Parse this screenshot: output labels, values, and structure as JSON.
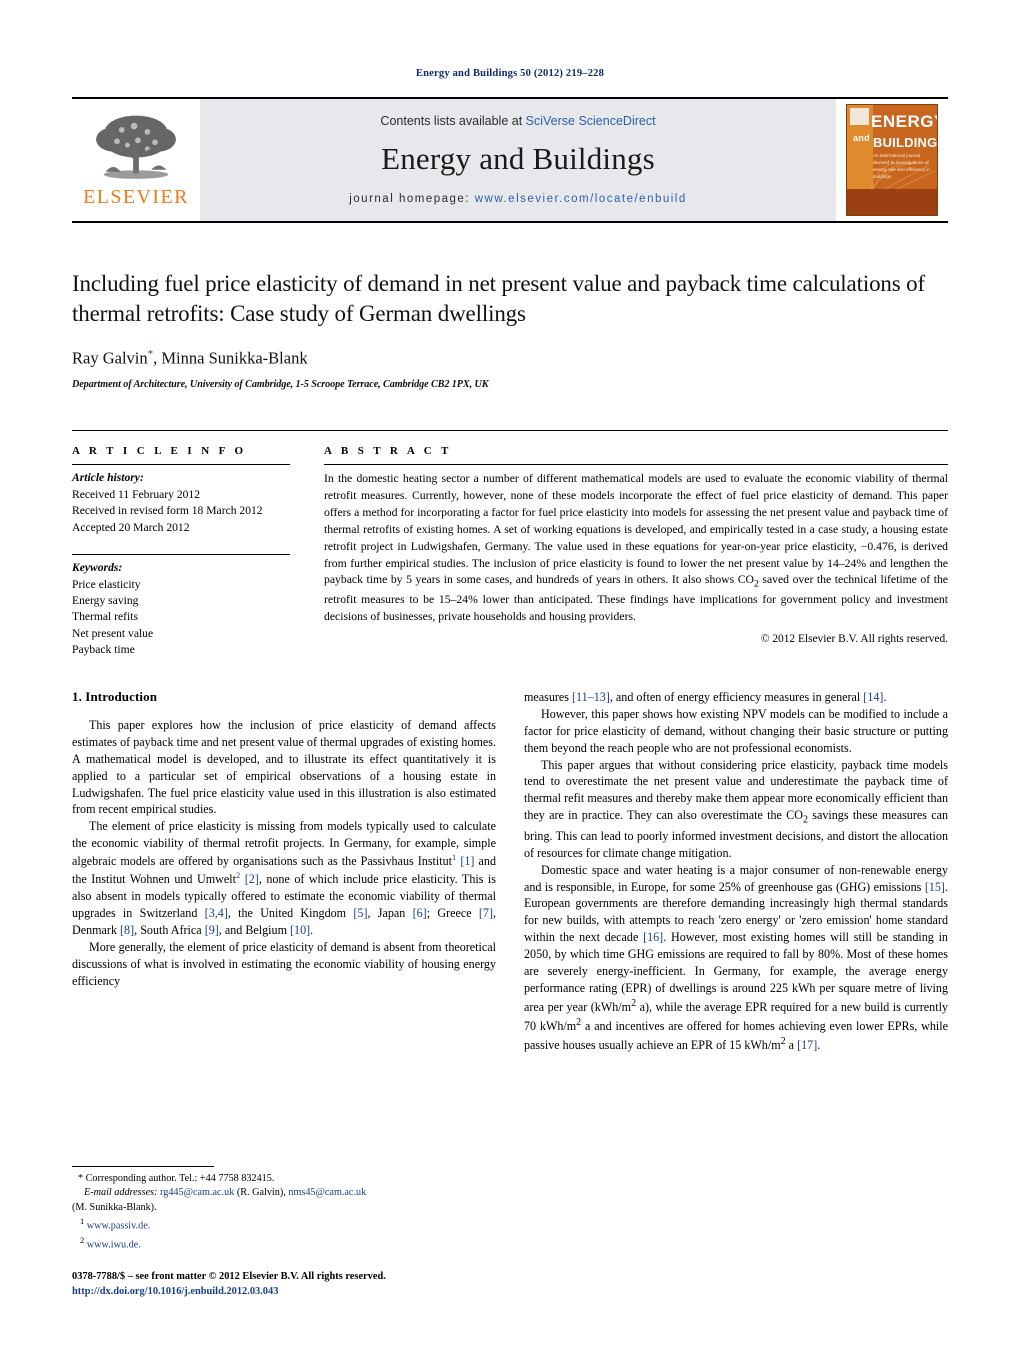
{
  "running_head": "Energy and Buildings 50 (2012) 219–228",
  "masthead": {
    "contents_prefix": "Contents lists available at ",
    "contents_link": "SciVerse ScienceDirect",
    "journal_name": "Energy and Buildings",
    "homepage_prefix": "journal homepage: ",
    "homepage_url": "www.elsevier.com/locate/enbuild",
    "publisher_wordmark": "ELSEVIER",
    "cover": {
      "line1": "ENERGY",
      "line2": "and",
      "line3": "BUILDINGS",
      "subtitle": "An international journal devoted to investigations of energy use and efficiency in buildings"
    }
  },
  "article": {
    "title": "Including fuel price elasticity of demand in net present value and payback time calculations of thermal retrofits: Case study of German dwellings",
    "authors": "Ray Galvin",
    "author_marker": "*",
    "authors_rest": ", Minna Sunikka-Blank",
    "affiliation": "Department of Architecture, University of Cambridge, 1-5 Scroope Terrace, Cambridge CB2 1PX, UK"
  },
  "info": {
    "heading": "A R T I C L E  I N F O",
    "history_label": "Article history:",
    "history": [
      "Received 11 February 2012",
      "Received in revised form 18 March 2012",
      "Accepted 20 March 2012"
    ],
    "keywords_label": "Keywords:",
    "keywords": [
      "Price elasticity",
      "Energy saving",
      "Thermal refits",
      "Net present value",
      "Payback time"
    ]
  },
  "abstract": {
    "heading": "A B S T R A C T",
    "text": "In the domestic heating sector a number of different mathematical models are used to evaluate the economic viability of thermal retrofit measures. Currently, however, none of these models incorporate the effect of fuel price elasticity of demand. This paper offers a method for incorporating a factor for fuel price elasticity into models for assessing the net present value and payback time of thermal retrofits of existing homes. A set of working equations is developed, and empirically tested in a case study, a housing estate retrofit project in Ludwigshafen, Germany. The value used in these equations for year-on-year price elasticity, −0.476, is derived from further empirical studies. The inclusion of price elasticity is found to lower the net present value by 14–24% and lengthen the payback time by 5 years in some cases, and hundreds of years in others. It also shows CO2 saved over the technical lifetime of the retrofit measures to be 15–24% lower than anticipated. These findings have implications for government policy and investment decisions of businesses, private households and housing providers.",
    "copyright": "© 2012 Elsevier B.V. All rights reserved."
  },
  "body": {
    "section_heading": "1.  Introduction",
    "left_paragraphs": [
      "This paper explores how the inclusion of price elasticity of demand affects estimates of payback time and net present value of thermal upgrades of existing homes. A mathematical model is developed, and to illustrate its effect quantitatively it is applied to a particular set of empirical observations of a housing estate in Ludwigshafen. The fuel price elasticity value used in this illustration is also estimated from recent empirical studies.",
      "The element of price elasticity is missing from models typically used to calculate the economic viability of thermal retrofit projects. In Germany, for example, simple algebraic models are offered by organisations such as the Passivhaus Institut1 [1] and the Institut Wohnen und Umwelt2 [2], none of which include price elasticity. This is also absent in models typically offered to estimate the economic viability of thermal upgrades in Switzerland [3,4], the United Kingdom [5], Japan [6]; Greece [7], Denmark [8], South Africa [9], and Belgium [10].",
      "More generally, the element of price elasticity of demand is absent from theoretical discussions of what is involved in estimating the economic viability of housing energy efficiency"
    ],
    "right_paragraphs": [
      "measures [11–13], and often of energy efficiency measures in general [14].",
      "However, this paper shows how existing NPV models can be modified to include a factor for price elasticity of demand, without changing their basic structure or putting them beyond the reach people who are not professional economists.",
      "This paper argues that without considering price elasticity, payback time models tend to overestimate the net present value and underestimate the payback time of thermal refit measures and thereby make them appear more economically efficient than they are in practice. They can also overestimate the CO2 savings these measures can bring. This can lead to poorly informed investment decisions, and distort the allocation of resources for climate change mitigation.",
      "Domestic space and water heating is a major consumer of non-renewable energy and is responsible, in Europe, for some 25% of greenhouse gas (GHG) emissions [15]. European governments are therefore demanding increasingly high thermal standards for new builds, with attempts to reach 'zero energy' or 'zero emission' home standard within the next decade [16]. However, most existing homes will still be standing in 2050, by which time GHG emissions are required to fall by 80%. Most of these homes are severely energy-inefficient. In Germany, for example, the average energy performance rating (EPR) of dwellings is around 225 kWh per square metre of living area per year (kWh/m2 a), while the average EPR required for a new build is currently 70 kWh/m2 a and incentives are offered for homes achieving even lower EPRs, while passive houses usually achieve an EPR of 15 kWh/m2 a [17]."
    ]
  },
  "footnotes": {
    "corresponding": "Corresponding author. Tel.: +44 7758 832415.",
    "email_label": "E-mail addresses:",
    "email1": "rg445@cam.ac.uk",
    "email1_name": "(R. Galvin),",
    "email2": "nms45@cam.ac.uk",
    "email2_name": "(M. Sunikka-Blank).",
    "note1_num": "1",
    "note1": "www.passiv.de.",
    "note2_num": "2",
    "note2": "www.iwu.de.",
    "issn_line": "0378-7788/$ – see front matter © 2012 Elsevier B.V. All rights reserved.",
    "doi": "http://dx.doi.org/10.1016/j.enbuild.2012.03.043"
  }
}
